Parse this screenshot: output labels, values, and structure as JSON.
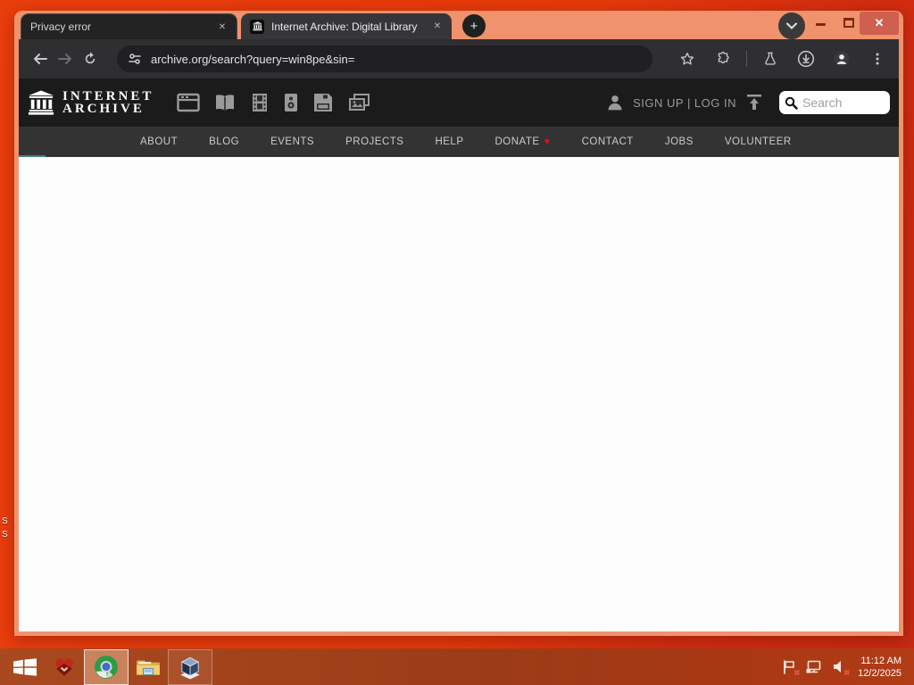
{
  "icons": {
    "plus": "+",
    "close": "✕",
    "heart": "♥",
    "badge_x": "✕"
  },
  "browser": {
    "tabs": [
      {
        "title": "Privacy error",
        "active": false
      },
      {
        "title": "Internet Archive: Digital Library",
        "active": true
      }
    ],
    "url": "archive.org/search?query=win8pe&sin="
  },
  "archive": {
    "logo_line1": "INTERNET",
    "logo_line2": "ARCHIVE",
    "signup_login": "SIGN UP | LOG IN",
    "search_placeholder": "Search",
    "media_types": [
      "web",
      "texts",
      "video",
      "audio",
      "software",
      "images"
    ],
    "nav": [
      {
        "label": "ABOUT"
      },
      {
        "label": "BLOG"
      },
      {
        "label": "EVENTS"
      },
      {
        "label": "PROJECTS"
      },
      {
        "label": "HELP"
      },
      {
        "label": "DONATE",
        "heart": true
      },
      {
        "label": "CONTACT"
      },
      {
        "label": "JOBS"
      },
      {
        "label": "VOLUNTEER"
      }
    ]
  },
  "taskbar": {
    "apps": [
      "start",
      "red-app",
      "chrome",
      "file-explorer",
      "virtualbox"
    ],
    "tray": [
      "action-center-flag",
      "network",
      "volume-muted"
    ],
    "clock": {
      "time": "11:12 AM",
      "date": "12/2/2025"
    }
  },
  "desktop": {
    "icon_label_fragments": [
      "S",
      "S"
    ]
  },
  "colors": {
    "desktop_orange": "#e63a0b",
    "window_frame": "#f0926c",
    "taskbar_red": "#a04420",
    "close_button": "#cf5f4e",
    "heart_red": "#e80c0c",
    "header_black": "#1b1b1b",
    "nav_gray": "#333333",
    "tab_inactive": "#232323",
    "tab_active": "#363639"
  }
}
